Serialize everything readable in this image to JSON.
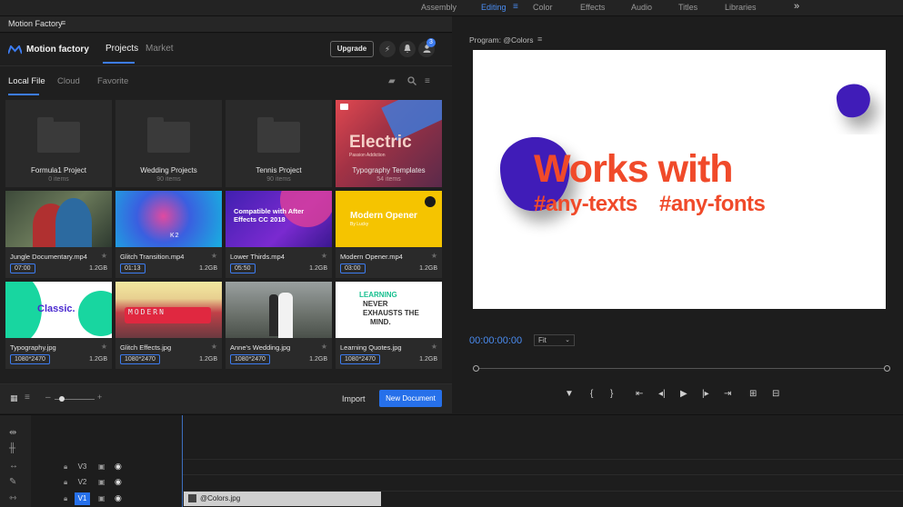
{
  "workspaces": {
    "items": [
      "Assembly",
      "Editing",
      "Color",
      "Effects",
      "Audio",
      "Titles",
      "Libraries"
    ],
    "active": "Editing",
    "more": "»"
  },
  "panel": {
    "title": "Motion Factory"
  },
  "extension": {
    "brand": "Motion factory",
    "tabs": [
      "Projects",
      "Market"
    ],
    "upgrade_label": "Upgrade",
    "notification_count": "3",
    "subtabs": [
      "Local File",
      "Cloud",
      "Favorite"
    ],
    "import_label": "Import",
    "new_document_label": "New Document",
    "accent": "#2670ea"
  },
  "folders": [
    {
      "name": "Formula1 Project",
      "count": "0 items"
    },
    {
      "name": "Wedding Projects",
      "count": "90 items"
    },
    {
      "name": "Tennis Project",
      "count": "90 items"
    },
    {
      "name": "Typography Templates",
      "count": "54 items",
      "thumb_title": "Electric",
      "thumb_sub": "Passion Addiction"
    }
  ],
  "media": [
    {
      "name": "Jungle Documentary.mp4",
      "tag": "07:00",
      "size": "1.2GB"
    },
    {
      "name": "Glitch Transition.mp4",
      "tag": "01:13",
      "size": "1.2GB",
      "thumb_text": "K2"
    },
    {
      "name": "Lower Thirds.mp4",
      "tag": "05:50",
      "size": "1.2GB",
      "thumb_text": "Compatible with After Effects CC 2018"
    },
    {
      "name": "Modern Opener.mp4",
      "tag": "03:00",
      "size": "1.2GB",
      "thumb_text": "Modern Opener",
      "thumb_sub": "By Lucky"
    },
    {
      "name": "Typography.jpg",
      "tag": "1080*2470",
      "size": "1.2GB",
      "thumb_text": "Classic."
    },
    {
      "name": "Glitch Effects.jpg",
      "tag": "1080*2470",
      "size": "1.2GB",
      "thumb_text": "MODERN"
    },
    {
      "name": "Anne's Wedding.jpg",
      "tag": "1080*2470",
      "size": "1.2GB"
    },
    {
      "name": "Learning Quotes.jpg",
      "tag": "1080*2470",
      "size": "1.2GB",
      "thumb_lines": [
        "LEARNING",
        "NEVER",
        "EXHAUSTS THE",
        "MIND."
      ]
    }
  ],
  "program": {
    "title": "Program: @Colors",
    "headline": "Works with",
    "tag1": "#any-texts",
    "tag2": "#any-fonts",
    "timecode": "00:00:00:00",
    "fit": "Fit",
    "headline_color": "#f04a2a",
    "blob_color": "#3f1fb8"
  },
  "timeline": {
    "tracks": [
      "V3",
      "V2",
      "V1"
    ],
    "active_track": "V1",
    "clip": "@Colors.jpg"
  }
}
